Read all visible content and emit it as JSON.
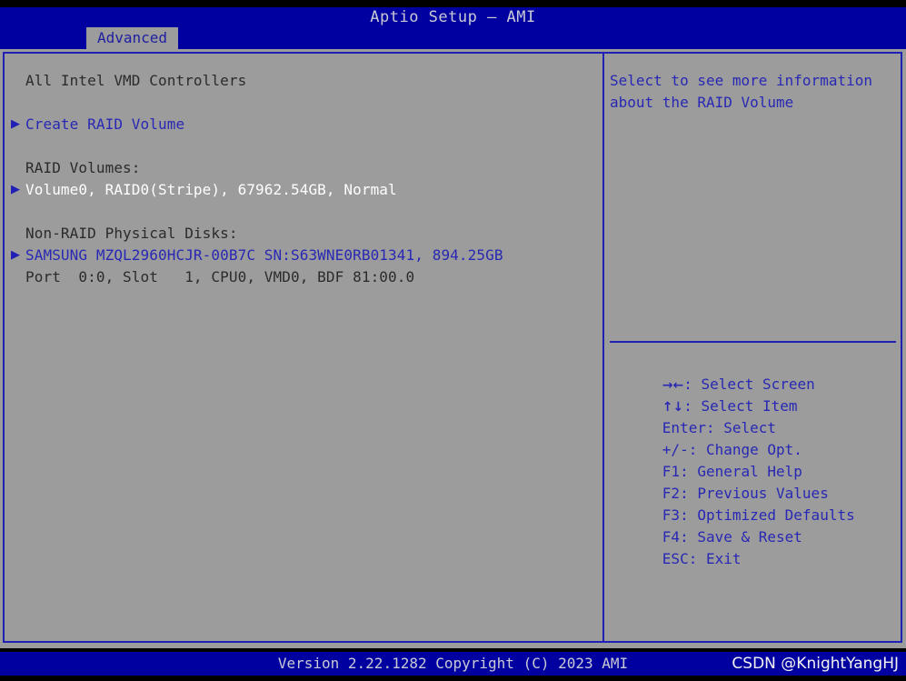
{
  "window": {
    "title": "Aptio Setup – AMI"
  },
  "menu": {
    "tabs": [
      {
        "label": "Advanced",
        "active": true
      }
    ]
  },
  "main": {
    "controllers_heading": "All Intel VMD Controllers",
    "create_raid_volume": "Create RAID Volume",
    "raid_volumes_heading": "RAID Volumes:",
    "raid_volume_entry": "Volume0, RAID0(Stripe), 67962.54GB, Normal",
    "non_raid_heading": "Non-RAID Physical Disks:",
    "disk_entry": "SAMSUNG MZQL2960HCJR-00B7C SN:S63WNE0RB01341, 894.25GB",
    "disk_detail": "Port  0:0, Slot   1, CPU0, VMD0, BDF 81:00.0"
  },
  "help": {
    "description_line1": "Select to see more information",
    "description_line2": "about the RAID Volume",
    "keys": [
      {
        "key": "→←",
        "action": ": Select Screen",
        "glyph": true
      },
      {
        "key": "↑↓",
        "action": ": Select Item",
        "glyph": true
      },
      {
        "key": "Enter",
        "action": ": Select",
        "glyph": false
      },
      {
        "key": "+/-",
        "action": ": Change Opt.",
        "glyph": false
      },
      {
        "key": "F1",
        "action": ": General Help",
        "glyph": false
      },
      {
        "key": "F2",
        "action": ": Previous Values",
        "glyph": false
      },
      {
        "key": "F3",
        "action": ": Optimized Defaults",
        "glyph": false
      },
      {
        "key": "F4",
        "action": ": Save & Reset",
        "glyph": false
      },
      {
        "key": "ESC",
        "action": ": Exit",
        "glyph": false
      }
    ]
  },
  "footer": {
    "version": "Version 2.22.1282 Copyright (C) 2023 AMI",
    "watermark": "CSDN @KnightYangHJ"
  },
  "icons": {
    "submenu_arrow": "▶"
  },
  "colors": {
    "header_blue": "#0000a0",
    "panel_gray": "#9c9c9c",
    "border_blue": "#2020b4",
    "text_blue": "#2828b4",
    "text_dark": "#2b2b2b",
    "text_selected": "#ffffff",
    "title_text": "#c9c9d6"
  }
}
